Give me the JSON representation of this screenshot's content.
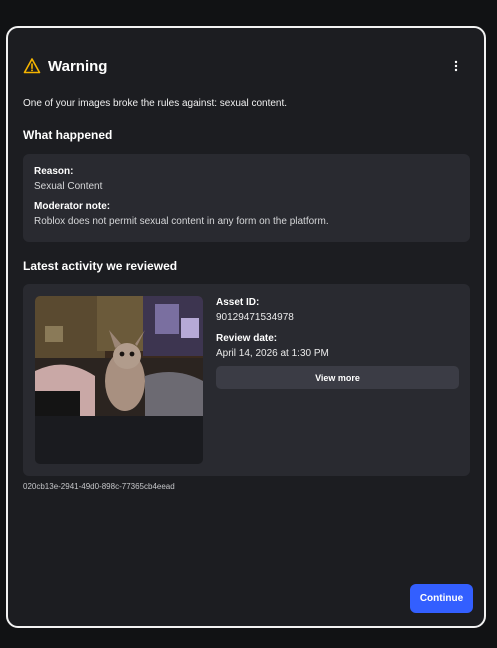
{
  "dialog": {
    "title": "Warning",
    "icon": "warning-triangle-icon",
    "menu_icon": "more-vertical-icon",
    "intro": "One of your images broke the rules against: sexual content."
  },
  "what_happened": {
    "heading": "What happened",
    "reason_label": "Reason:",
    "reason_value": "Sexual Content",
    "note_label": "Moderator note:",
    "note_value": "Roblox does not permit sexual content in any form on the platform."
  },
  "activity": {
    "heading": "Latest activity we reviewed",
    "asset_label": "Asset ID:",
    "asset_value": "90129471534978",
    "date_label": "Review date:",
    "date_value": "April 14, 2026 at 1:30 PM",
    "view_more_label": "View more",
    "reference_id": "020cb13e-2941-49d0-898c-77365cb4eead"
  },
  "footer": {
    "continue_label": "Continue"
  },
  "colors": {
    "accent": "#335fff",
    "warning": "#f5b400",
    "background": "#1c1d21",
    "card": "#292a30"
  }
}
